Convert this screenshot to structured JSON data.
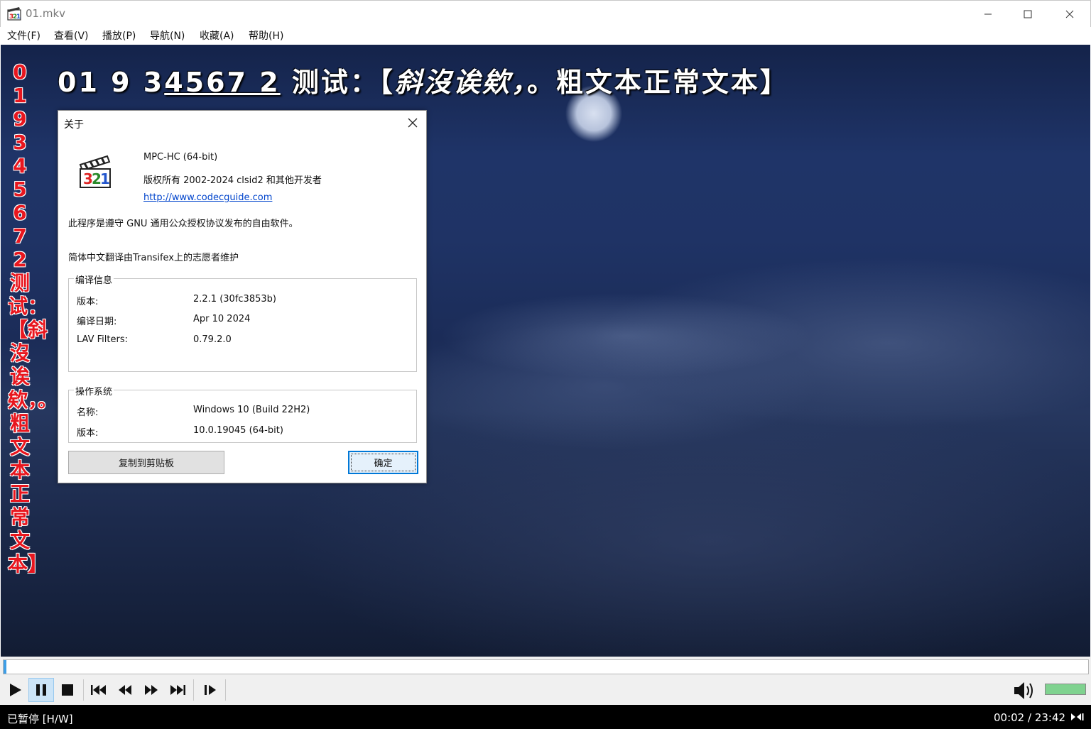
{
  "window": {
    "title": "01.mkv"
  },
  "menu": [
    "文件(F)",
    "查看(V)",
    "播放(P)",
    "导航(N)",
    "收藏(A)",
    "帮助(H)"
  ],
  "subtitles": {
    "top": {
      "p1": "01 9 3",
      "p2": "4567 2",
      "p3": "  测试：【",
      "p4": "斜沒诶欸，",
      "p5": "。粗文本正常文本】"
    },
    "vertical": "01 9 34567 2 测试：【斜沒诶欸，。粗文本正常文本】"
  },
  "dialog": {
    "title": "关于",
    "app_name": "MPC-HC (64-bit)",
    "copyright": "版权所有 2002-2024 clsid2 和其他开发者",
    "url": "http://www.codecguide.com",
    "license": "此程序是遵守 GNU 通用公众授权协议发布的自由软件。",
    "translation": "简体中文翻译由Transifex上的志愿者维护",
    "build": {
      "legend": "编译信息",
      "rows": [
        {
          "label": "版本:",
          "value": "2.2.1 (30fc3853b)"
        },
        {
          "label": "编译日期:",
          "value": "Apr 10 2024"
        },
        {
          "label": "LAV Filters:",
          "value": "0.79.2.0"
        }
      ]
    },
    "os": {
      "legend": "操作系统",
      "rows": [
        {
          "label": "名称:",
          "value": "Windows 10 (Build 22H2)"
        },
        {
          "label": "版本:",
          "value": "10.0.19045 (64-bit)"
        }
      ]
    },
    "copy_button": "复制到剪贴板",
    "ok_button": "确定"
  },
  "player": {
    "seek_progress": 0.0014,
    "volume_level": 1.0,
    "accent_color": "#3e9ee6",
    "volume_color": "#7fd28f"
  },
  "status": {
    "state": "已暂停 [H/W]",
    "time": "00:02 / 23:42"
  }
}
